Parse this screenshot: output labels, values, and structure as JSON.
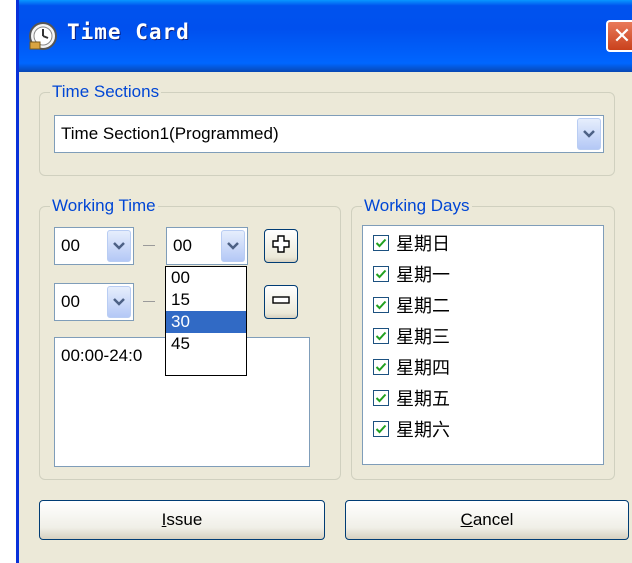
{
  "window": {
    "title": "Time Card",
    "close_symbol": "✕"
  },
  "time_sections": {
    "label": "Time Sections",
    "selected": "Time Section1(Programmed)"
  },
  "working_time": {
    "label": "Working Time",
    "row1": {
      "start": "00",
      "end": "00"
    },
    "row2": {
      "start": "00"
    },
    "add_symbol": "+",
    "remove_symbol": "−",
    "list_items": [
      "00:00-24:0"
    ],
    "open_dropdown": {
      "options": [
        "00",
        "15",
        "30",
        "45"
      ],
      "highlighted": "30"
    }
  },
  "working_days": {
    "label": "Working Days",
    "days": [
      {
        "label": "星期日",
        "checked": true
      },
      {
        "label": "星期一",
        "checked": true
      },
      {
        "label": "星期二",
        "checked": true
      },
      {
        "label": "星期三",
        "checked": true
      },
      {
        "label": "星期四",
        "checked": true
      },
      {
        "label": "星期五",
        "checked": true
      },
      {
        "label": "星期六",
        "checked": true
      }
    ]
  },
  "buttons": {
    "issue_mnemonic": "I",
    "issue_rest": "ssue",
    "cancel_mnemonic": "C",
    "cancel_rest": "ancel"
  },
  "colors": {
    "titlebar": "#0054e3",
    "group_label": "#0046d5",
    "selection": "#316ac5",
    "checkmark": "#21a121"
  }
}
